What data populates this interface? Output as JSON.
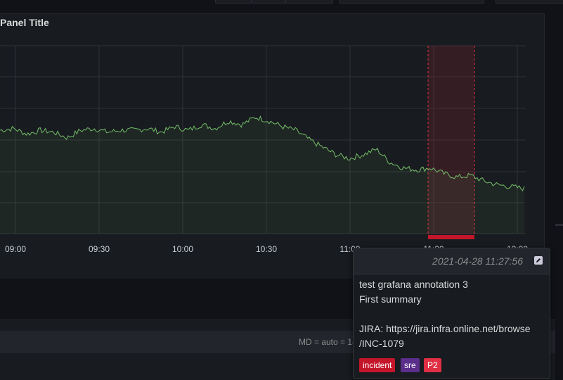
{
  "panel": {
    "title": "Panel Title"
  },
  "chart_data": {
    "type": "area",
    "x_ticks": [
      "09:00",
      "09:30",
      "10:00",
      "10:30",
      "11:00",
      "11:30",
      "12:00"
    ],
    "series": [
      {
        "color": "#73bf69",
        "values": [
          55,
          56,
          53,
          55,
          54,
          51,
          55,
          56,
          54,
          55,
          55,
          56,
          54,
          57,
          55,
          58,
          56,
          60,
          58,
          62,
          60,
          57,
          55,
          50,
          46,
          42,
          40,
          42,
          45,
          38,
          35,
          34,
          35,
          32,
          30,
          31,
          28,
          26,
          25,
          24
        ]
      }
    ],
    "annotation_region": {
      "start": "11:26",
      "end": "11:34",
      "color": "#e02f44"
    },
    "grid": true
  },
  "bottom": {
    "md_text": "MD = auto = 14"
  },
  "tooltip": {
    "time": "2021-04-28 11:27:56",
    "lines": [
      "test grafana annotation 3",
      "First summary",
      "",
      "JIRA: https://jira.infra.online.net/browse",
      "/INC-1079"
    ],
    "tags": [
      {
        "label": "incident",
        "color": "#c4162a"
      },
      {
        "label": "sre",
        "color": "#5a2e8a"
      },
      {
        "label": "P2",
        "color": "#e02f44"
      }
    ],
    "edit_icon": "pencil-icon"
  }
}
